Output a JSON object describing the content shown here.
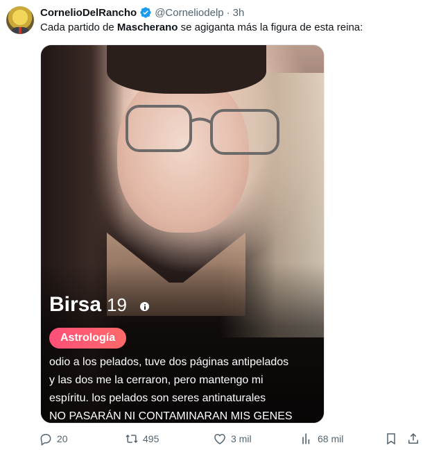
{
  "tweet": {
    "author_name": "CornelioDelRancho",
    "handle": "@Corneliodelp",
    "separator": "·",
    "time": "3h",
    "text_before": "Cada partido de ",
    "text_bold": "Mascherano",
    "text_after": " se agiganta más la figura de esta reina:"
  },
  "card": {
    "name": "Birsa",
    "age": "19",
    "interest_tag": "Astrología",
    "bio_lines": [
      "odio a los pelados, tuve dos páginas antipelados",
      "y las dos me la cerraron, pero mantengo mi",
      "espíritu. los pelados son seres antinaturales",
      "NO PASARÁN NI CONTAMINARAN MIS GENES"
    ],
    "interest_color": "#ff5a73"
  },
  "actions": {
    "replies": "20",
    "retweets": "495",
    "likes": "3 mil",
    "views": "68 mil"
  },
  "icons": {
    "verified": "verified-badge-icon",
    "reply": "reply-icon",
    "retweet": "retweet-icon",
    "like": "heart-icon",
    "views": "views-icon",
    "bookmark": "bookmark-icon",
    "share": "share-icon"
  },
  "colors": {
    "verified": "#1d9bf0",
    "muted": "#536471"
  }
}
